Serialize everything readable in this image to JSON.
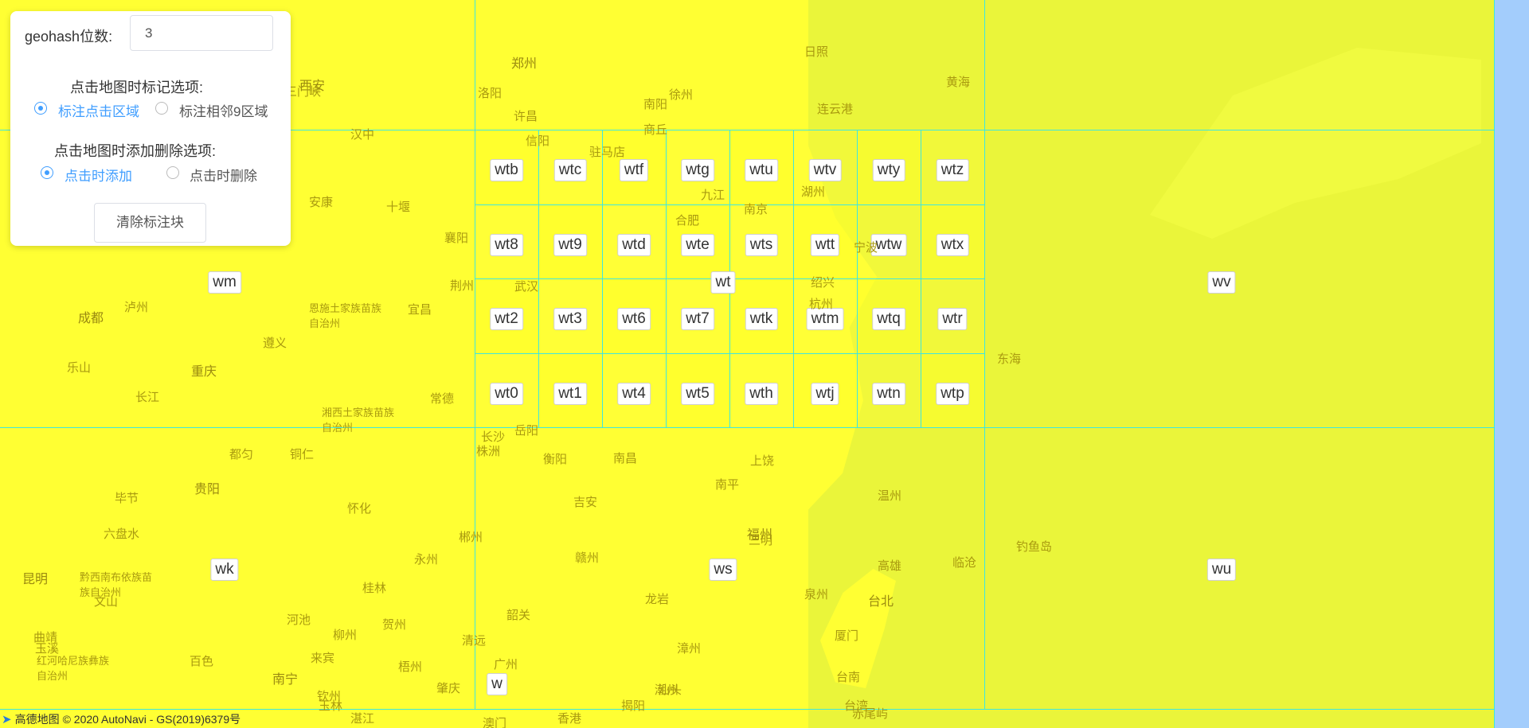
{
  "panel": {
    "digits_label": "geohash位数:",
    "digits_value": "3",
    "mark_title": "点击地图时标记选项:",
    "mark_opt1": "标注点击区域",
    "mark_opt2": "标注相邻9区域",
    "add_title": "点击地图时添加删除选项:",
    "add_opt1": "点击时添加",
    "add_opt2": "点击时删除",
    "clear_button": "清除标注块"
  },
  "large_cells": [
    "wm",
    "wt",
    "wv",
    "wk",
    "ws",
    "wu"
  ],
  "small_cells": [
    [
      "wtb",
      "wtc",
      "wtf",
      "wtg",
      "wtu",
      "wtv",
      "wty",
      "wtz"
    ],
    [
      "wt8",
      "wt9",
      "wtd",
      "wte",
      "wts",
      "wtt",
      "wtw",
      "wtx"
    ],
    [
      "wt2",
      "wt3",
      "wt6",
      "wt7",
      "wtk",
      "wtm",
      "wtq",
      "wtr"
    ],
    [
      "wt0",
      "wt1",
      "wt4",
      "wt5",
      "wth",
      "wtj",
      "wtn",
      "wtp"
    ]
  ],
  "cities": [
    "郑州",
    "西安",
    "成都",
    "重庆",
    "武汉",
    "合肥",
    "南京",
    "杭州",
    "长沙",
    "贵阳",
    "昆明",
    "南宁",
    "广州",
    "福州",
    "台北",
    "香港",
    "澳门",
    "黄海",
    "东海",
    "恩施土家族苗族自治州",
    "湘西土家族苗族自治州",
    "黔西南布依族苗族自治州",
    "红河哈尼族彝族自治州",
    "长江",
    "乐山",
    "许昌",
    "洛阳",
    "南阳",
    "荆州",
    "宜昌",
    "襄阳",
    "十堰",
    "安康",
    "汉中",
    "泸州",
    "遵义",
    "赣州",
    "南昌",
    "衡阳",
    "桂林",
    "柳州",
    "梧州",
    "厦门",
    "泉州",
    "三明",
    "南平",
    "上饶",
    "温州",
    "台湾",
    "三门峡",
    "日照",
    "连云港",
    "徐州",
    "商丘",
    "驻马店",
    "信阳",
    "九江",
    "宁波",
    "绍兴",
    "湖州",
    "常德",
    "岳阳",
    "株洲",
    "吉安",
    "龙岩",
    "漳州",
    "潮州",
    "揭阳",
    "汕头",
    "韶关",
    "清远",
    "肇庆",
    "湛江",
    "玉林",
    "钦州",
    "百色",
    "河池",
    "来宾",
    "贺州",
    "永州",
    "郴州",
    "怀化",
    "铜仁",
    "都匀",
    "毕节",
    "六盘水",
    "曲靖",
    "玉溪",
    "文山",
    "临沧",
    "钓鱼岛",
    "赤尾屿",
    "台南",
    "高雄",
    "基隆"
  ],
  "footer": {
    "brand": "高德地图",
    "copyright": "© 2020 AutoNavi - GS(2019)6379号"
  },
  "colors": {
    "highlight": "#ffff33",
    "grid_line": "#3ee6e0",
    "sea": "#a3cdfc",
    "accent": "#409eff"
  }
}
